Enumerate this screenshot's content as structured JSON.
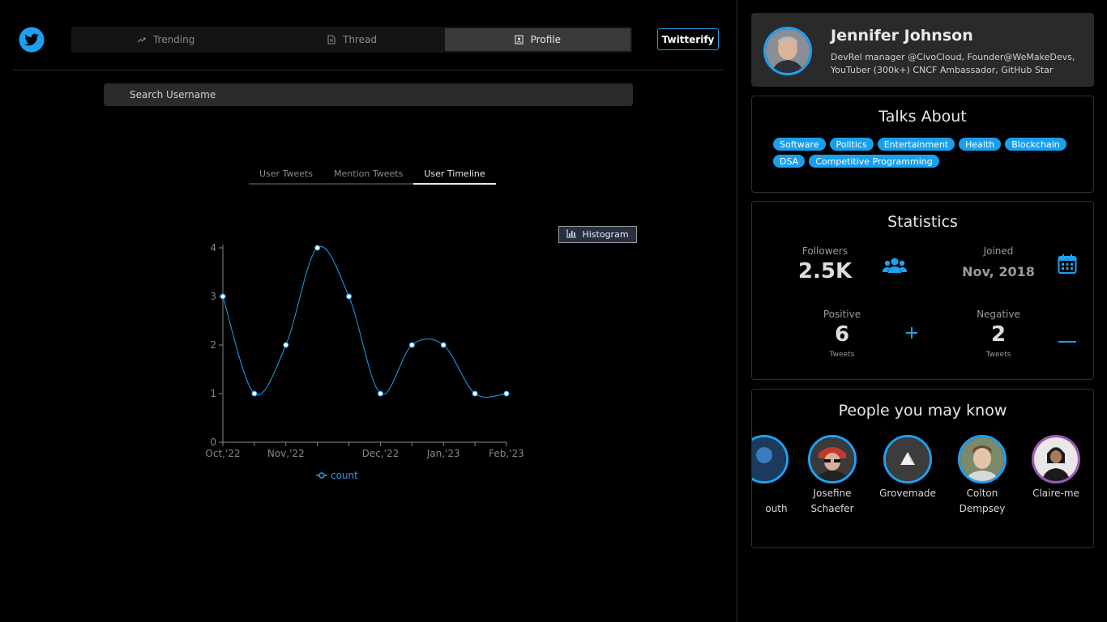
{
  "nav": {
    "tabs": [
      {
        "label": "Trending",
        "icon": "trending-icon"
      },
      {
        "label": "Thread",
        "icon": "document-icon"
      },
      {
        "label": "Profile",
        "icon": "profile-icon"
      }
    ],
    "active_tab": "Profile",
    "brand_button": "Twitterify"
  },
  "search": {
    "placeholder": "Search Username",
    "value": ""
  },
  "subtabs": {
    "items": [
      "User Tweets",
      "Mention Tweets",
      "User Timeline"
    ],
    "active": "User Timeline"
  },
  "histogram_button": "Histogram",
  "chart_data": {
    "type": "line",
    "x": [
      "Oct,'22",
      "",
      "Nov,'22",
      "",
      "",
      "Dec,'22",
      "",
      "Jan,'23",
      "",
      "Feb,'23"
    ],
    "x_tick_labels": [
      "Oct,'22",
      "Nov,'22",
      "Dec,'22",
      "Jan,'23",
      "Feb,'23"
    ],
    "series": [
      {
        "name": "count",
        "values": [
          3,
          1,
          2,
          4,
          3,
          1,
          2,
          2,
          1,
          1
        ],
        "color": "#1da1f2"
      }
    ],
    "yticks": [
      0,
      1,
      2,
      3,
      4
    ],
    "ylim": [
      0,
      4
    ],
    "grid": false,
    "legend": "bottom-center",
    "smooth": true
  },
  "profile": {
    "name": "Jennifer Johnson",
    "bio": "DevRel manager @CivoCloud, Founder@WeMakeDevs, YouTuber (300k+) CNCF Ambassador, GitHub Star"
  },
  "talks": {
    "title": "Talks About",
    "tags": [
      "Software",
      "Politics",
      "Entertainment",
      "Health",
      "Blockchain",
      "DSA",
      "Competitive Programming"
    ]
  },
  "stats": {
    "title": "Statistics",
    "followers_label": "Followers",
    "followers_value": "2.5K",
    "joined_label": "Joined",
    "joined_value": "Nov, 2018",
    "positive_label": "Positive",
    "positive_value": "6",
    "positive_unit": "Tweets",
    "negative_label": "Negative",
    "negative_value": "2",
    "negative_unit": "Tweets",
    "icons": {
      "followers": "group-icon",
      "joined": "calendar-icon",
      "positive": "plus-icon",
      "negative": "minus-icon"
    }
  },
  "people": {
    "title": "People you may know",
    "items": [
      {
        "name": "outh"
      },
      {
        "name": "Josefine Schaefer"
      },
      {
        "name": "Grovemade"
      },
      {
        "name": "Colton Dempsey"
      },
      {
        "name": "Claire-me"
      }
    ]
  },
  "colors": {
    "accent": "#1da1f2",
    "panel": "#2a2a2a",
    "background": "#000000"
  }
}
